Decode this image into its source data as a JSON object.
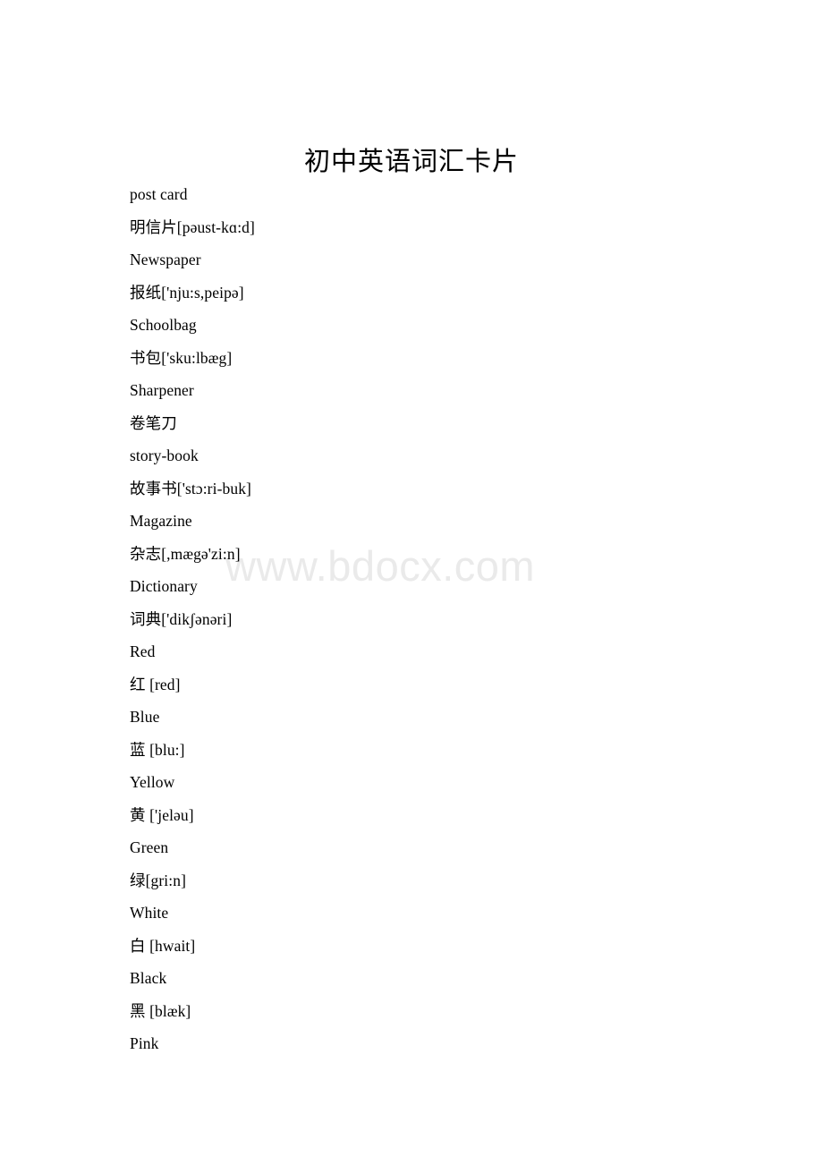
{
  "document": {
    "title": "初中英语词汇卡片",
    "watermark": "www.bdocx.com"
  },
  "entries": [
    {
      "english": "post card",
      "chinese": "明信片[pəust-kɑ:d]"
    },
    {
      "english": "Newspaper",
      "chinese": "报纸['nju:s,peipə]"
    },
    {
      "english": "Schoolbag",
      "chinese": "书包['sku:lbæg]"
    },
    {
      "english": "Sharpener",
      "chinese": "卷笔刀"
    },
    {
      "english": "story-book",
      "chinese": "故事书['stɔ:ri-buk]"
    },
    {
      "english": "Magazine",
      "chinese": "杂志[,mægə'zi:n]"
    },
    {
      "english": "Dictionary",
      "chinese": "词典['dikʃənəri]"
    },
    {
      "english": "Red",
      "chinese": "红 [red]"
    },
    {
      "english": "Blue",
      "chinese": "蓝 [blu:]"
    },
    {
      "english": "Yellow",
      "chinese": "黄 ['jeləu]"
    },
    {
      "english": "Green",
      "chinese": "绿[gri:n]"
    },
    {
      "english": "White",
      "chinese": "白 [hwait]"
    },
    {
      "english": "Black",
      "chinese": "黑 [blæk]"
    },
    {
      "english": "Pink",
      "chinese": null
    }
  ],
  "lines": [
    "post card",
    "明信片[pəust-kɑ:d]",
    "Newspaper",
    "报纸['nju:s,peipə]",
    "Schoolbag",
    "书包['sku:lbæg]",
    "Sharpener",
    "卷笔刀",
    "story-book",
    "故事书['stɔ:ri-buk]",
    "Magazine",
    "杂志[,mægə'zi:n]",
    "Dictionary",
    "词典['dikʃənəri]",
    "Red",
    "红 [red]",
    "Blue",
    "蓝 [blu:]",
    "Yellow",
    "黄 ['jeləu]",
    "Green",
    "绿[gri:n]",
    "White",
    "白 [hwait]",
    "Black",
    "黑 [blæk]",
    "Pink"
  ],
  "colors": {
    "page_background": "#ffffff",
    "text": "#000000",
    "watermark": "#eaeaea"
  }
}
